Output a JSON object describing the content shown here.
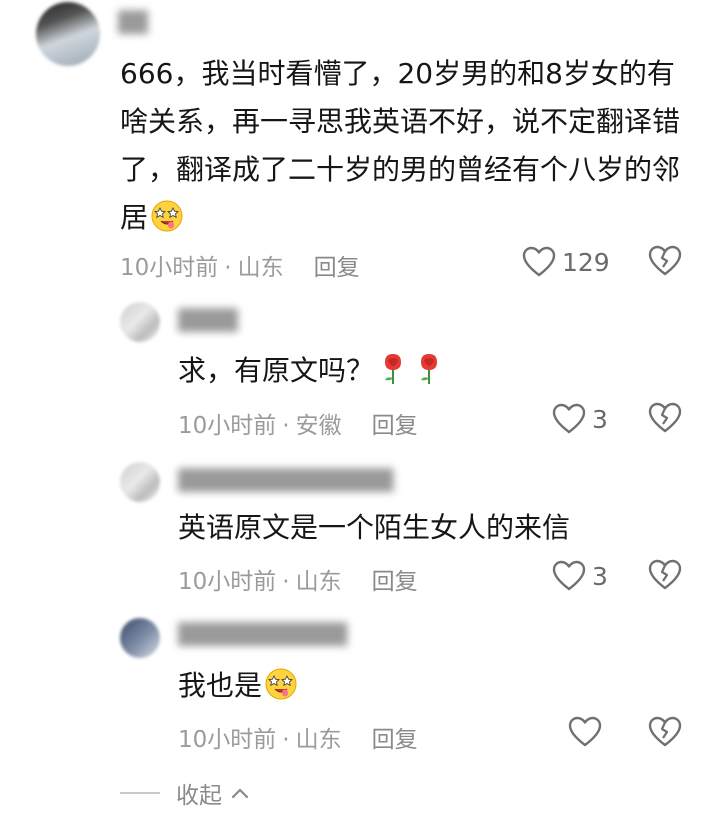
{
  "main_comment": {
    "text": "666，我当时看懵了，20岁男的和8岁女的有啥关系，再一寻思我英语不好，说不定翻译错了，翻译成了二十岁的男的曾经有个八岁的邻居",
    "emoji": "drooling-star-eyes-emoji",
    "time": "10小时前",
    "location": "山东",
    "reply_label": "回复",
    "likes": "129"
  },
  "replies": [
    {
      "text": "求，有原文吗？",
      "emoji": "rose-emoji",
      "time": "10小时前",
      "location": "安徽",
      "reply_label": "回复",
      "likes": "3"
    },
    {
      "text": "英语原文是一个陌生女人的来信",
      "time": "10小时前",
      "location": "山东",
      "reply_label": "回复",
      "likes": "3"
    },
    {
      "text": "我也是",
      "emoji": "drooling-star-eyes-emoji",
      "time": "10小时前",
      "location": "山东",
      "reply_label": "回复",
      "likes": ""
    }
  ],
  "collapse_label": "收起",
  "separator": "·",
  "colors": {
    "text": "#161616",
    "meta": "#9b9b9b",
    "icon": "#707070"
  }
}
